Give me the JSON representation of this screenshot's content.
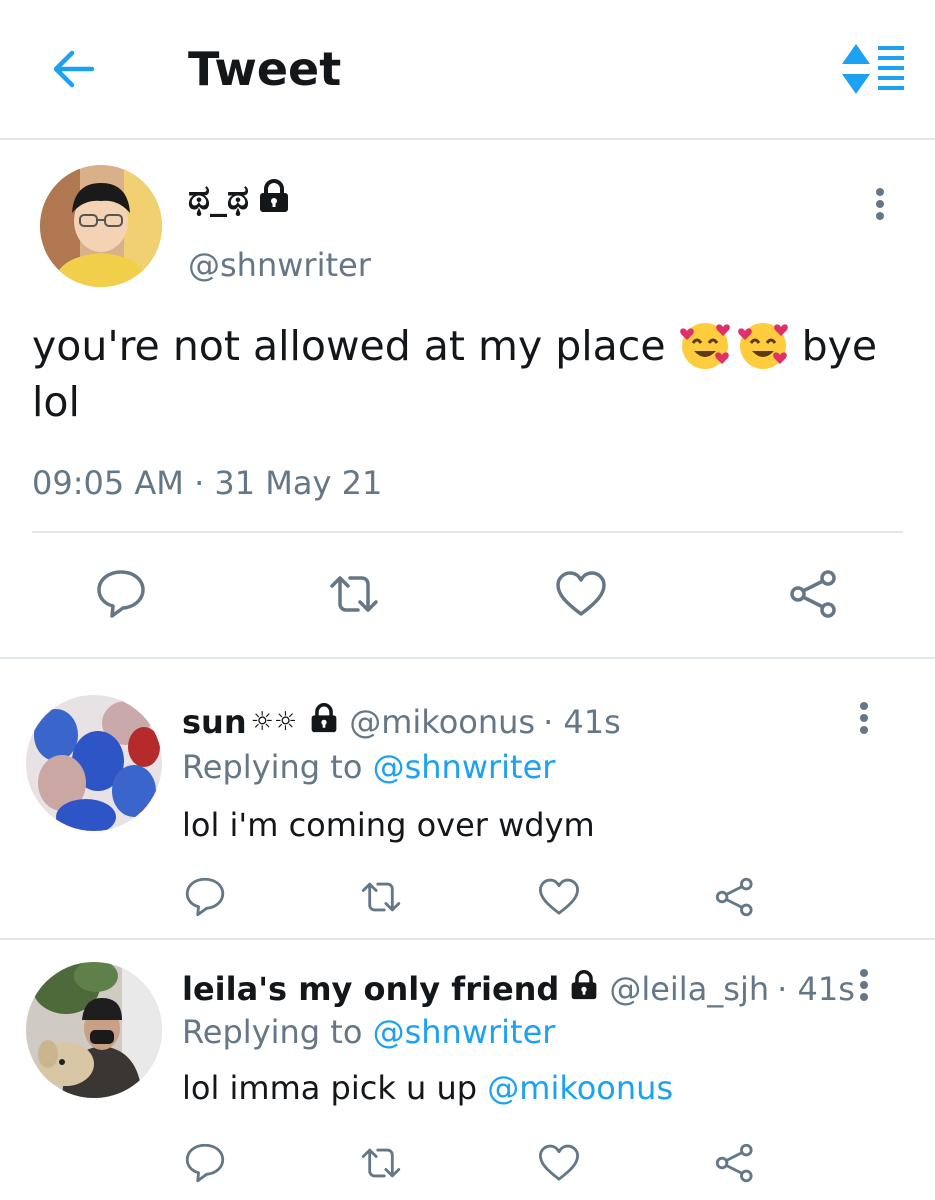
{
  "header": {
    "title": "Tweet"
  },
  "main_tweet": {
    "display_name": "ಥ_ಥ",
    "handle": "@shnwriter",
    "text_line1": "you're not allowed at my place",
    "text_after_emoji": "bye",
    "text_line2": "lol",
    "time": "09:05 AM",
    "separator": "·",
    "date": "31 May 21"
  },
  "replies": [
    {
      "display_name": "sun",
      "deco": "☼☼",
      "handle": "@mikoonus",
      "time": "· 41s",
      "replying_prefix": "Replying to",
      "replying_handle": "@shnwriter",
      "text": "lol i'm coming over wdym"
    },
    {
      "display_name": "leila's my only friend",
      "handle": "@leila_sjh",
      "time": "· 41s",
      "replying_prefix": "Replying to",
      "replying_handle": "@shnwriter",
      "text": "lol imma pick u up",
      "mention": "@mikoonus"
    }
  ],
  "colors": {
    "accent": "#1da1f2",
    "secondary_text": "#657786",
    "primary_text": "#14171a",
    "divider": "#e1e8ed"
  }
}
